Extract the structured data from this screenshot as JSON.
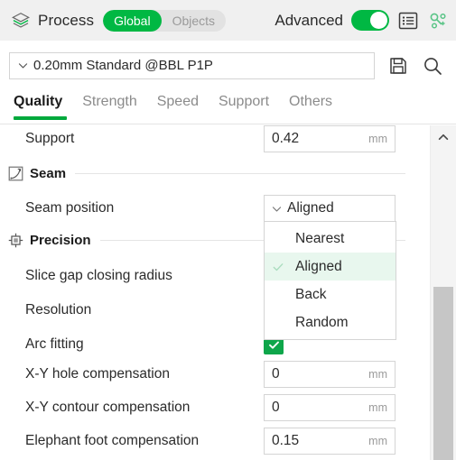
{
  "header": {
    "process_icon": "layers-icon",
    "title": "Process",
    "segments": [
      {
        "label": "Global",
        "active": true
      },
      {
        "label": "Objects",
        "active": false
      }
    ],
    "advanced_label": "Advanced",
    "advanced_on": true,
    "list_icon": "list-view-icon",
    "compare_icon": "compare-presets-icon",
    "accent_color": "#00b843"
  },
  "preset": {
    "value": "0.20mm Standard @BBL P1P",
    "chevron_icon": "chevron-down-icon",
    "save_icon": "save-icon",
    "search_icon": "search-icon"
  },
  "tabs": [
    {
      "label": "Quality",
      "active": true
    },
    {
      "label": "Strength",
      "active": false
    },
    {
      "label": "Speed",
      "active": false
    },
    {
      "label": "Support",
      "active": false
    },
    {
      "label": "Others",
      "active": false
    }
  ],
  "settings": {
    "support_row": {
      "label": "Support",
      "value": "0.42",
      "unit": "mm"
    },
    "seam_section": {
      "icon": "seam-icon",
      "title": "Seam"
    },
    "seam_position": {
      "label": "Seam position",
      "value": "Aligned",
      "chevron_icon": "chevron-down-icon"
    },
    "precision_section": {
      "icon": "precision-target-icon",
      "title": "Precision"
    },
    "slice_gap": {
      "label": "Slice gap closing radius"
    },
    "resolution": {
      "label": "Resolution"
    },
    "arc_fitting": {
      "label": "Arc fitting",
      "checked": true,
      "check_icon": "check-icon"
    },
    "xy_hole": {
      "label": "X-Y hole compensation",
      "value": "0",
      "unit": "mm"
    },
    "xy_contour": {
      "label": "X-Y contour compensation",
      "value": "0",
      "unit": "mm"
    },
    "elephant_foot": {
      "label": "Elephant foot compensation",
      "value": "0.15",
      "unit": "mm"
    }
  },
  "dropdown": {
    "open": true,
    "selected": "Aligned",
    "check_icon": "check-icon",
    "options": [
      {
        "label": "Nearest",
        "selected": false
      },
      {
        "label": "Aligned",
        "selected": true
      },
      {
        "label": "Back",
        "selected": false
      },
      {
        "label": "Random",
        "selected": false
      }
    ]
  },
  "scrollbar": {
    "up_icon": "chevron-up-icon"
  }
}
